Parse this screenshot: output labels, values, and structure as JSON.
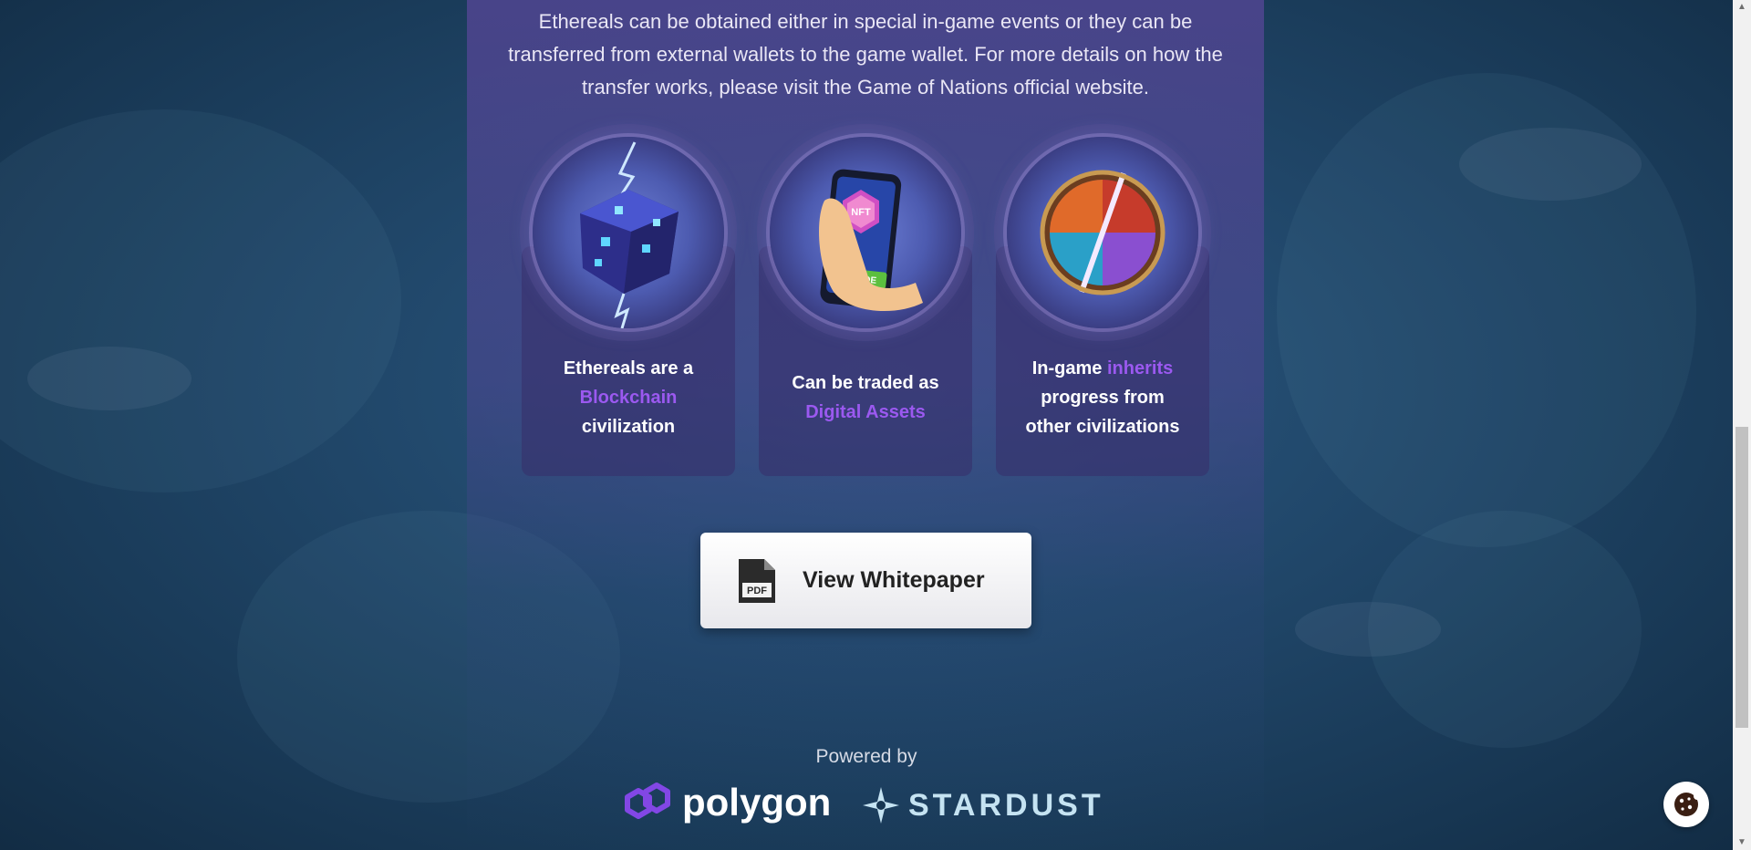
{
  "intro": {
    "line1": "Ethereals can be obtained either in special in-game events or they can be",
    "line2": "transferred from external wallets to the game wallet. For more details on how the",
    "line3": "transfer works, please visit the Game of Nations official website."
  },
  "features": [
    {
      "icon": "blockchain-cube-icon",
      "before": "Ethereals are a",
      "highlight": "Blockchain",
      "after": "civilization"
    },
    {
      "icon": "nft-phone-trade-icon",
      "before": "Can be traded as",
      "highlight": "Digital Assets",
      "after": "",
      "badge_nft": "NFT",
      "badge_trade": "TRADE"
    },
    {
      "icon": "elemental-orb-icon",
      "before": "In-game",
      "highlight": "inherits",
      "after_line1": "progress from",
      "after_line2": "other civilizations"
    }
  ],
  "whitepaper_button": {
    "label": "View Whitepaper",
    "icon_label": "PDF"
  },
  "footer": {
    "powered_by": "Powered by",
    "polygon": "polygon",
    "stardust": "STARDUST"
  },
  "colors": {
    "highlight": "#9b59f0",
    "stardust": "#c5e3f2",
    "polygon_purple": "#8247e5"
  }
}
